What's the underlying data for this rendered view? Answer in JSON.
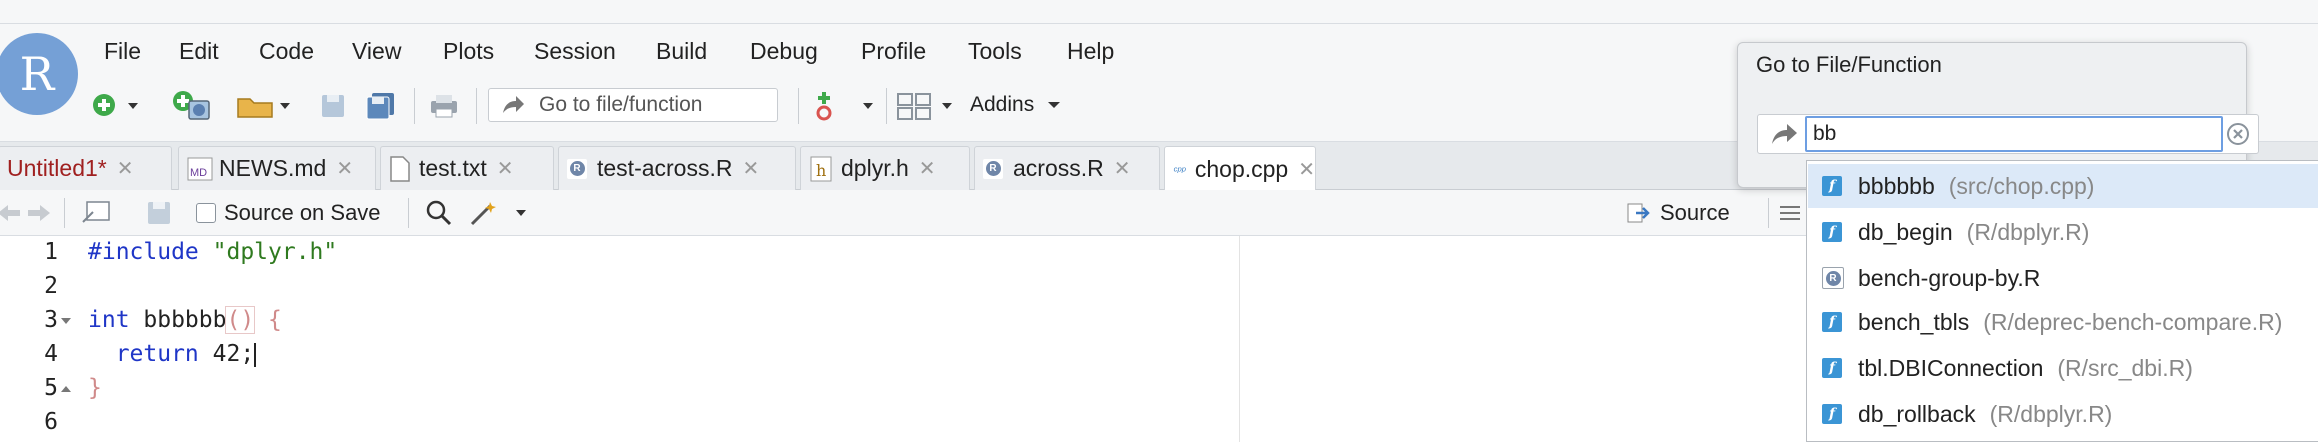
{
  "app": {
    "logo_letter": "R",
    "accent": "#75a0d6"
  },
  "menu": [
    "File",
    "Edit",
    "Code",
    "View",
    "Plots",
    "Session",
    "Build",
    "Debug",
    "Profile",
    "Tools",
    "Help"
  ],
  "toolbar": {
    "goto_placeholder": "Go to file/function",
    "addins_label": "Addins",
    "icons": [
      "new-file-icon",
      "new-project-icon",
      "open-folder-icon",
      "save-icon",
      "save-all-icon",
      "print-icon",
      "git-icon",
      "grid-layout-icon"
    ]
  },
  "tabs": [
    {
      "label": "Untitled1*",
      "icon": "none",
      "active": false,
      "modified": true
    },
    {
      "label": "NEWS.md",
      "icon": "md-file-icon",
      "active": false,
      "modified": false
    },
    {
      "label": "test.txt",
      "icon": "text-file-icon",
      "active": false,
      "modified": false
    },
    {
      "label": "test-across.R",
      "icon": "r-file-icon",
      "active": false,
      "modified": false
    },
    {
      "label": "dplyr.h",
      "icon": "h-file-icon",
      "active": false,
      "modified": false
    },
    {
      "label": "across.R",
      "icon": "r-file-icon",
      "active": false,
      "modified": false
    },
    {
      "label": "chop.cpp",
      "icon": "cpp-file-icon",
      "active": true,
      "modified": false
    }
  ],
  "editor_toolbar": {
    "source_on_save": "Source on Save",
    "source_button": "Source",
    "md_badge": "MD",
    "cpp_badge": "cpp",
    "h_badge": "h",
    "r_badge": "R"
  },
  "editor": {
    "line_numbers": [
      "1",
      "2",
      "3",
      "4",
      "5",
      "6"
    ],
    "lines": {
      "l1_kw": "#include",
      "l1_str": " \"dplyr.h\"",
      "l3_kw": "int",
      "l3_name": " bbbbbb",
      "l3_paren": "()",
      "l3_brace": " {",
      "l4_kw": "  return",
      "l4_num": " 42",
      "l4_semi": ";",
      "l5_brace": "}"
    }
  },
  "dialog": {
    "title": "Go to File/Function",
    "query": "bb",
    "results": [
      {
        "name": "bbbbbb",
        "path": "(src/chop.cpp)",
        "type": "function",
        "selected": true
      },
      {
        "name": "db_begin",
        "path": "(R/dbplyr.R)",
        "type": "function",
        "selected": false
      },
      {
        "name": "bench-group-by.R",
        "path": "",
        "type": "r-file",
        "selected": false
      },
      {
        "name": "bench_tbls",
        "path": "(R/deprec-bench-compare.R)",
        "type": "function",
        "selected": false
      },
      {
        "name": "tbl.DBIConnection",
        "path": "(R/src_dbi.R)",
        "type": "function",
        "selected": false
      },
      {
        "name": "db_rollback",
        "path": "(R/dbplyr.R)",
        "type": "function",
        "selected": false
      }
    ]
  }
}
